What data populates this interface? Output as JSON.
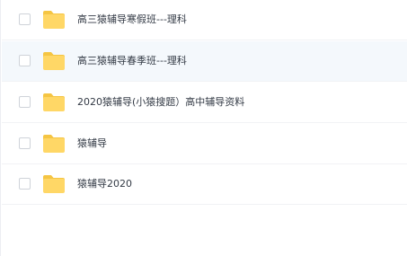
{
  "file_list": {
    "items": [
      {
        "name": "高三猿辅导寒假班---理科",
        "type": "folder",
        "icon": "folder-icon"
      },
      {
        "name": "高三猿辅导春季班---理科",
        "type": "folder",
        "icon": "folder-icon"
      },
      {
        "name": "2020猿辅导(小猿搜题）高中辅导资料",
        "type": "folder",
        "icon": "folder-icon"
      },
      {
        "name": "猿辅导",
        "type": "folder",
        "icon": "folder-icon"
      },
      {
        "name": "猿辅导2020",
        "type": "folder",
        "icon": "folder-icon"
      }
    ]
  },
  "colors": {
    "folder": "#ffd766",
    "folder_tab": "#f5c543",
    "hover_row": "#f4f8fc",
    "text": "#333a45"
  }
}
